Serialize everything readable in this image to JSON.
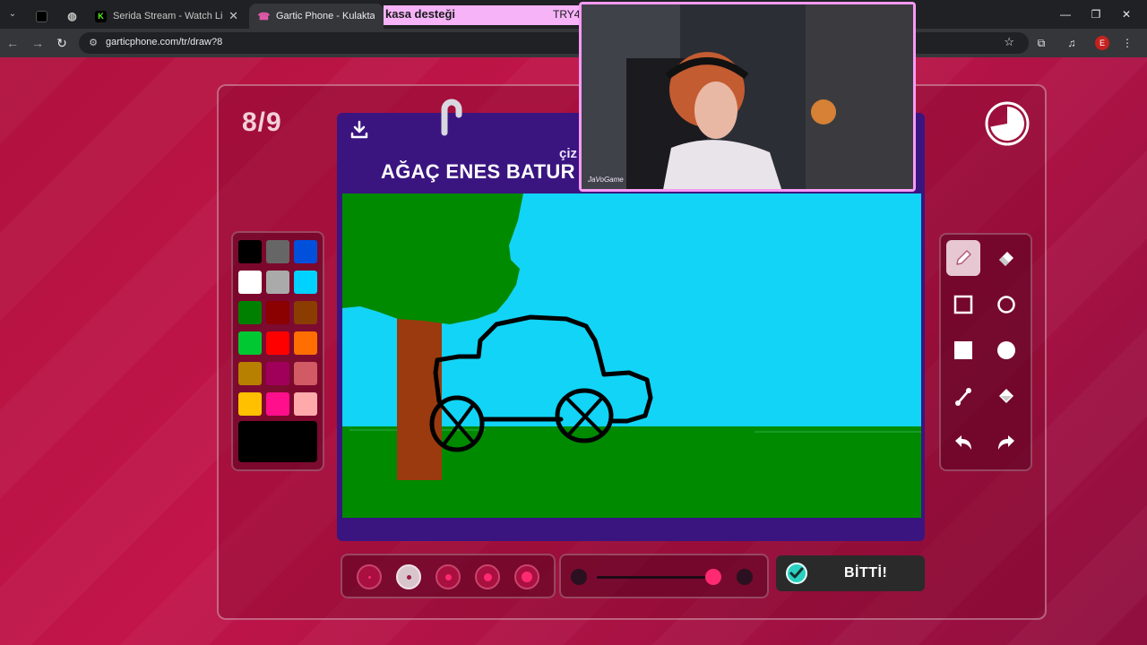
{
  "browser": {
    "tabs": [
      {
        "title": "Serida Stream - Watch Live on Kick",
        "active": false,
        "favicon_color": "#53fc18"
      },
      {
        "title": "Gartic Phone - Kulaktan Kulağa",
        "active": true,
        "favicon_color": "#e05aa8"
      }
    ],
    "url": "garticphone.com/tr/draw?8",
    "profile_initial": "E"
  },
  "overlay": {
    "donation_text": "kasa desteği",
    "donation_code": "TRY4",
    "streamer_tag": "JaVoGame"
  },
  "game": {
    "round": "8/9",
    "instruction": "çiz",
    "prompt": "AĞAÇ ENES BATUR",
    "done_label": "BİTTİ!",
    "timer_remaining_fraction": 0.72,
    "selected_tool": "pencil",
    "selected_size_index": 1,
    "opacity_fraction": 0.93,
    "current_color": "#000000",
    "palette": [
      "#000000",
      "#666666",
      "#0050dc",
      "#ffffff",
      "#aaaaaa",
      "#00d2ff",
      "#008000",
      "#8b0000",
      "#8b3c00",
      "#00c832",
      "#ff0000",
      "#ff6e00",
      "#b88000",
      "#a0005a",
      "#d25a64",
      "#ffc000",
      "#ff0f8c",
      "#ffaaaa"
    ],
    "tools": [
      "pencil",
      "eraser",
      "rectangle-outline",
      "circle-outline",
      "rectangle-filled",
      "circle-filled",
      "line",
      "fill-bucket",
      "undo",
      "redo"
    ],
    "colors": {
      "sky": "#12d4f6",
      "grass": "#008a00",
      "trunk": "#9b3a0e",
      "leaves": "#008a00"
    }
  }
}
